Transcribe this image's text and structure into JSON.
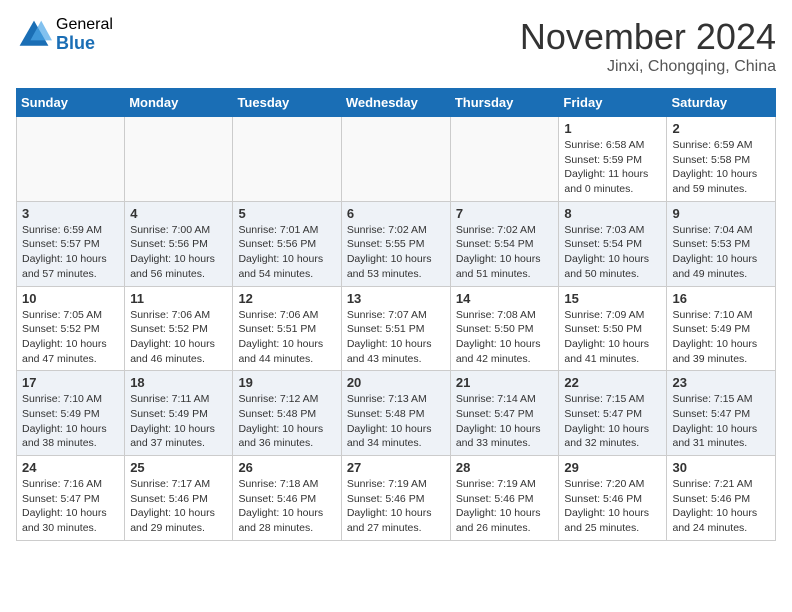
{
  "header": {
    "logo_general": "General",
    "logo_blue": "Blue",
    "month_title": "November 2024",
    "location": "Jinxi, Chongqing, China"
  },
  "days_of_week": [
    "Sunday",
    "Monday",
    "Tuesday",
    "Wednesday",
    "Thursday",
    "Friday",
    "Saturday"
  ],
  "weeks": [
    [
      {
        "num": "",
        "info": ""
      },
      {
        "num": "",
        "info": ""
      },
      {
        "num": "",
        "info": ""
      },
      {
        "num": "",
        "info": ""
      },
      {
        "num": "",
        "info": ""
      },
      {
        "num": "1",
        "info": "Sunrise: 6:58 AM\nSunset: 5:59 PM\nDaylight: 11 hours\nand 0 minutes."
      },
      {
        "num": "2",
        "info": "Sunrise: 6:59 AM\nSunset: 5:58 PM\nDaylight: 10 hours\nand 59 minutes."
      }
    ],
    [
      {
        "num": "3",
        "info": "Sunrise: 6:59 AM\nSunset: 5:57 PM\nDaylight: 10 hours\nand 57 minutes."
      },
      {
        "num": "4",
        "info": "Sunrise: 7:00 AM\nSunset: 5:56 PM\nDaylight: 10 hours\nand 56 minutes."
      },
      {
        "num": "5",
        "info": "Sunrise: 7:01 AM\nSunset: 5:56 PM\nDaylight: 10 hours\nand 54 minutes."
      },
      {
        "num": "6",
        "info": "Sunrise: 7:02 AM\nSunset: 5:55 PM\nDaylight: 10 hours\nand 53 minutes."
      },
      {
        "num": "7",
        "info": "Sunrise: 7:02 AM\nSunset: 5:54 PM\nDaylight: 10 hours\nand 51 minutes."
      },
      {
        "num": "8",
        "info": "Sunrise: 7:03 AM\nSunset: 5:54 PM\nDaylight: 10 hours\nand 50 minutes."
      },
      {
        "num": "9",
        "info": "Sunrise: 7:04 AM\nSunset: 5:53 PM\nDaylight: 10 hours\nand 49 minutes."
      }
    ],
    [
      {
        "num": "10",
        "info": "Sunrise: 7:05 AM\nSunset: 5:52 PM\nDaylight: 10 hours\nand 47 minutes."
      },
      {
        "num": "11",
        "info": "Sunrise: 7:06 AM\nSunset: 5:52 PM\nDaylight: 10 hours\nand 46 minutes."
      },
      {
        "num": "12",
        "info": "Sunrise: 7:06 AM\nSunset: 5:51 PM\nDaylight: 10 hours\nand 44 minutes."
      },
      {
        "num": "13",
        "info": "Sunrise: 7:07 AM\nSunset: 5:51 PM\nDaylight: 10 hours\nand 43 minutes."
      },
      {
        "num": "14",
        "info": "Sunrise: 7:08 AM\nSunset: 5:50 PM\nDaylight: 10 hours\nand 42 minutes."
      },
      {
        "num": "15",
        "info": "Sunrise: 7:09 AM\nSunset: 5:50 PM\nDaylight: 10 hours\nand 41 minutes."
      },
      {
        "num": "16",
        "info": "Sunrise: 7:10 AM\nSunset: 5:49 PM\nDaylight: 10 hours\nand 39 minutes."
      }
    ],
    [
      {
        "num": "17",
        "info": "Sunrise: 7:10 AM\nSunset: 5:49 PM\nDaylight: 10 hours\nand 38 minutes."
      },
      {
        "num": "18",
        "info": "Sunrise: 7:11 AM\nSunset: 5:49 PM\nDaylight: 10 hours\nand 37 minutes."
      },
      {
        "num": "19",
        "info": "Sunrise: 7:12 AM\nSunset: 5:48 PM\nDaylight: 10 hours\nand 36 minutes."
      },
      {
        "num": "20",
        "info": "Sunrise: 7:13 AM\nSunset: 5:48 PM\nDaylight: 10 hours\nand 34 minutes."
      },
      {
        "num": "21",
        "info": "Sunrise: 7:14 AM\nSunset: 5:47 PM\nDaylight: 10 hours\nand 33 minutes."
      },
      {
        "num": "22",
        "info": "Sunrise: 7:15 AM\nSunset: 5:47 PM\nDaylight: 10 hours\nand 32 minutes."
      },
      {
        "num": "23",
        "info": "Sunrise: 7:15 AM\nSunset: 5:47 PM\nDaylight: 10 hours\nand 31 minutes."
      }
    ],
    [
      {
        "num": "24",
        "info": "Sunrise: 7:16 AM\nSunset: 5:47 PM\nDaylight: 10 hours\nand 30 minutes."
      },
      {
        "num": "25",
        "info": "Sunrise: 7:17 AM\nSunset: 5:46 PM\nDaylight: 10 hours\nand 29 minutes."
      },
      {
        "num": "26",
        "info": "Sunrise: 7:18 AM\nSunset: 5:46 PM\nDaylight: 10 hours\nand 28 minutes."
      },
      {
        "num": "27",
        "info": "Sunrise: 7:19 AM\nSunset: 5:46 PM\nDaylight: 10 hours\nand 27 minutes."
      },
      {
        "num": "28",
        "info": "Sunrise: 7:19 AM\nSunset: 5:46 PM\nDaylight: 10 hours\nand 26 minutes."
      },
      {
        "num": "29",
        "info": "Sunrise: 7:20 AM\nSunset: 5:46 PM\nDaylight: 10 hours\nand 25 minutes."
      },
      {
        "num": "30",
        "info": "Sunrise: 7:21 AM\nSunset: 5:46 PM\nDaylight: 10 hours\nand 24 minutes."
      }
    ]
  ]
}
